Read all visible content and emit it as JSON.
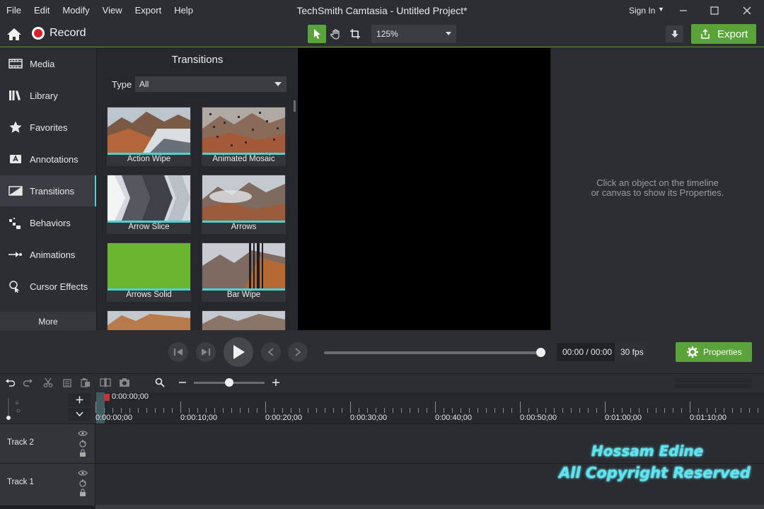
{
  "menu": [
    "File",
    "Edit",
    "Modify",
    "View",
    "Export",
    "Help"
  ],
  "app_title": "TechSmith Camtasia - Untitled Project*",
  "signin": "Sign In",
  "toolbar": {
    "record_label": "Record",
    "zoom": "125%",
    "export_label": "Export"
  },
  "sidebar": {
    "items": [
      {
        "label": "Media",
        "icon": "film-icon"
      },
      {
        "label": "Library",
        "icon": "library-icon"
      },
      {
        "label": "Favorites",
        "icon": "star-icon"
      },
      {
        "label": "Annotations",
        "icon": "annotation-icon"
      },
      {
        "label": "Transitions",
        "icon": "transition-icon",
        "active": true
      },
      {
        "label": "Behaviors",
        "icon": "behaviors-icon"
      },
      {
        "label": "Animations",
        "icon": "animation-icon"
      },
      {
        "label": "Cursor Effects",
        "icon": "cursor-icon"
      }
    ],
    "more": "More"
  },
  "transitions": {
    "title": "Transitions",
    "type_label": "Type",
    "type_value": "All",
    "items": [
      "Action Wipe",
      "Animated Mosaic",
      "Arrow Slice",
      "Arrows",
      "Arrows Solid",
      "Bar Wipe"
    ]
  },
  "properties": {
    "message_line1": "Click an object on the timeline",
    "message_line2": "or canvas to show its Properties.",
    "button": "Properties"
  },
  "player": {
    "time": "00:00 / 00:00",
    "fps": "30 fps",
    "progress": 1.0
  },
  "timeline": {
    "playhead": "0:00:00;00",
    "ticks": [
      "0:00:00;00",
      "0:00:10;00",
      "0:00:20;00",
      "0:00:30;00",
      "0:00:40;00",
      "0:00:50;00",
      "0:01:00;00",
      "0:01:10;00"
    ],
    "tracks": [
      "Track 2",
      "Track 1"
    ]
  },
  "watermark": {
    "line1": "Hossam Edine",
    "line2": "All Copyright Reserved"
  },
  "colors": {
    "accent_green": "#5aa33a",
    "accent_cyan": "#4fd1d9",
    "record_red": "#d8202a"
  }
}
